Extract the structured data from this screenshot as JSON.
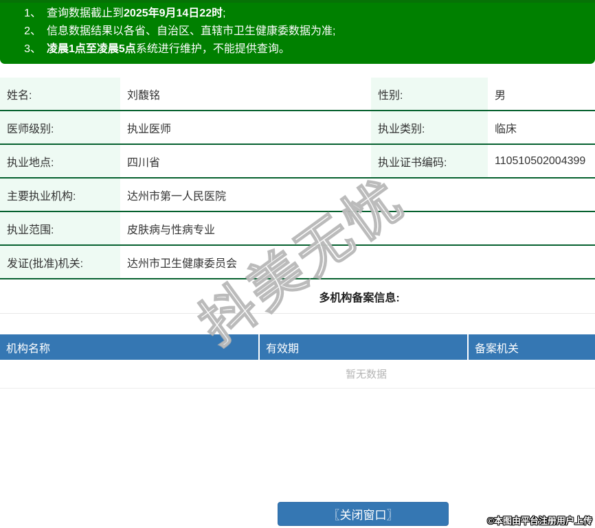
{
  "notice": {
    "items": [
      {
        "num": "1、",
        "pre": "查询数据截止到",
        "bold": "2025年9月14日22时",
        "post": ";"
      },
      {
        "num": "2、",
        "pre": "信息数据结果以各省、自治区、直辖市卫生健康委数据为准;",
        "bold": "",
        "post": ""
      },
      {
        "num": "3、",
        "pre": "",
        "bold": "凌晨1点至凌晨5点",
        "post": "系统进行维护，不能提供查询。"
      }
    ]
  },
  "profile": {
    "rows": [
      {
        "label": "姓名:",
        "value": "刘馥铭",
        "label2": "性别:",
        "value2": "男"
      },
      {
        "label": "医师级别:",
        "value": "执业医师",
        "label2": "执业类别:",
        "value2": "临床"
      },
      {
        "label": "执业地点:",
        "value": "四川省",
        "label2": "执业证书编码:",
        "value2": "110510502004399"
      },
      {
        "label": "主要执业机构:",
        "value": "达州市第一人民医院"
      },
      {
        "label": "执业范围:",
        "value": "皮肤病与性病专业"
      },
      {
        "label": "发证(批准)机关:",
        "value": "达州市卫生健康委员会"
      }
    ]
  },
  "section": {
    "title": "多机构备案信息:"
  },
  "record_table": {
    "headers": [
      "机构名称",
      "有效期",
      "备案机关"
    ],
    "empty_text": "暂无数据"
  },
  "footer": {
    "close_button": "〖关闭窗口〗",
    "credit": "©本图由平台注册用户上传"
  },
  "watermark": {
    "text": "抖美无忧"
  },
  "colors": {
    "notice_green": "#008000",
    "row_border_green": "#05602e",
    "label_mint": "#eefaf3",
    "header_blue": "#3577b3",
    "empty_gray": "#b5b5b5"
  }
}
